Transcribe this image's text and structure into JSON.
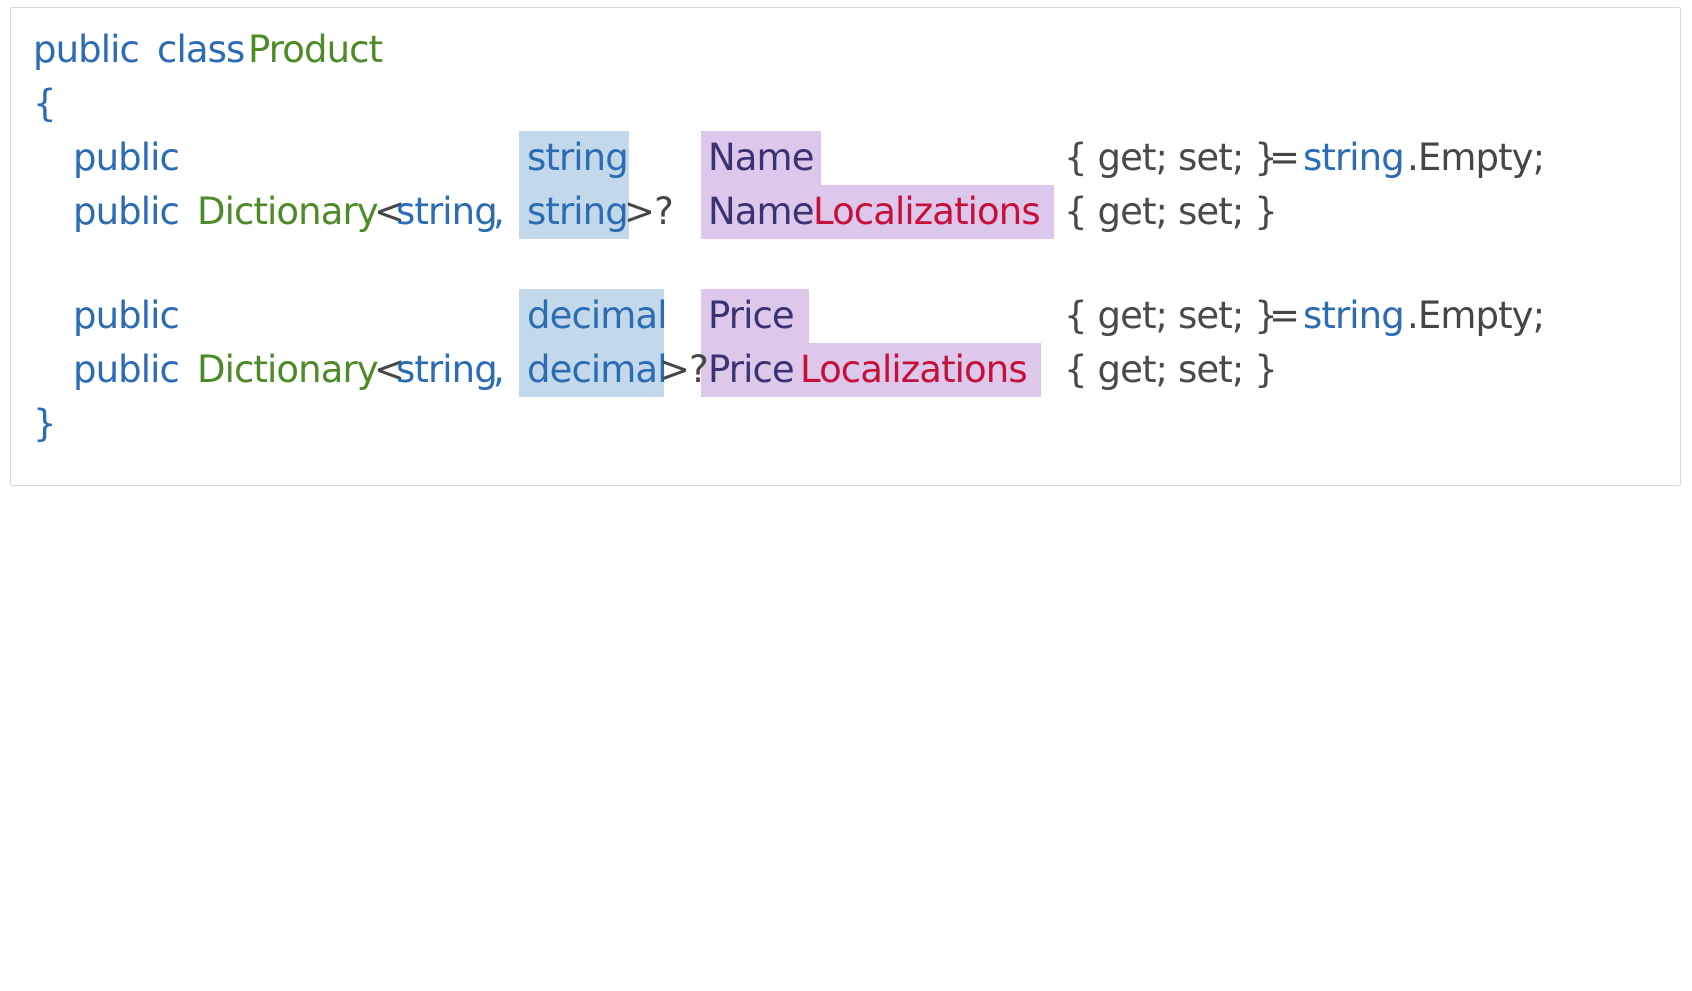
{
  "card": {
    "language": "csharp",
    "background": "#ffffff",
    "border_color": "#d9d9d9"
  },
  "colors": {
    "keyword_blue": "#2b6cb5",
    "type_green": "#4e8a28",
    "plain_dark": "#464646",
    "property_indigo": "#3b3272",
    "suffix_red": "#c4103a",
    "brace_gray": "#4a4a4a",
    "highlight_type": "#c3d8ea",
    "highlight_name": "#ddc8ec"
  },
  "code": {
    "line1": {
      "kw_public": "public",
      "kw_class": "class",
      "type_name": "Product"
    },
    "line2": {
      "brace_open": "{"
    },
    "line3": {
      "kw_public": "public",
      "type": "string",
      "property": "Name",
      "accessors": "{ get; set; }",
      "equals": "=",
      "init_type": "string",
      "init_member": ".Empty;"
    },
    "line4": {
      "kw_public": "public",
      "dict_type": "Dictionary",
      "angle_open": "<",
      "generic_key": "string",
      "comma": ",",
      "generic_value": "string",
      "angle_close_nullable": ">?",
      "property_prefix": "Name",
      "property_suffix": "Localizations",
      "accessors": "{ get; set; }"
    },
    "line6": {
      "kw_public": "public",
      "type": "decimal",
      "property": "Price",
      "accessors": "{ get; set; }",
      "equals": "=",
      "init_type": "string",
      "init_member": ".Empty;"
    },
    "line7": {
      "kw_public": "public",
      "dict_type": "Dictionary",
      "angle_open": "<",
      "generic_key": "string",
      "comma": ",",
      "generic_value": "decimal",
      "angle_close_nullable": ">?",
      "property_prefix": "Price",
      "property_suffix": "Localizations",
      "accessors": "{ get; set; }"
    },
    "line8": {
      "brace_close": "}"
    }
  }
}
